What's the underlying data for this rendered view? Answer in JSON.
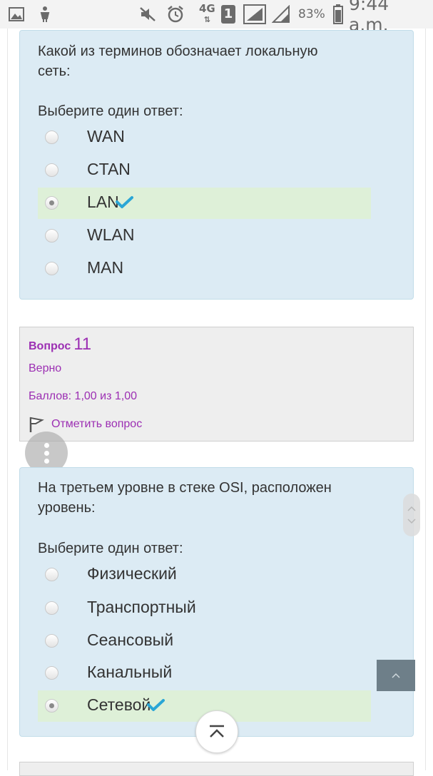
{
  "status_bar": {
    "network": "4G",
    "sim": "1",
    "battery": "83%",
    "time": "9:44 a.m."
  },
  "question_prev": {
    "prompt_line1": "Какой из терминов обозначает локальную",
    "prompt_line2": "сеть:",
    "choose_label": "Выберите один ответ:",
    "options": [
      {
        "text": "WAN",
        "selected": false,
        "correct": false
      },
      {
        "text": "CTAN",
        "selected": false,
        "correct": false
      },
      {
        "text": "LAN",
        "selected": true,
        "correct": true
      },
      {
        "text": "WLAN",
        "selected": false,
        "correct": false
      },
      {
        "text": "MAN",
        "selected": false,
        "correct": false
      }
    ]
  },
  "question_info": {
    "label": "Вопрос",
    "number": "11",
    "state": "Верно",
    "grade": "Баллов: 1,00 из 1,00",
    "flag_label": "Отметить вопрос"
  },
  "question_current": {
    "prompt_line1": "На третьем уровне в стеке OSI, расположен",
    "prompt_line2": "уровень:",
    "choose_label": "Выберите один ответ:",
    "options": [
      {
        "text": "Физический",
        "selected": false,
        "correct": false
      },
      {
        "text": "Транспортный",
        "selected": false,
        "correct": false
      },
      {
        "text": "Сеансовый",
        "selected": false,
        "correct": false
      },
      {
        "text": "Канальный",
        "selected": false,
        "correct": false
      },
      {
        "text": "Сетевой",
        "selected": true,
        "correct": true
      }
    ]
  },
  "colors": {
    "question_bg": "#dcebf4",
    "correct_bg": "#def0d8",
    "info_accent": "#9c2fb3",
    "check": "#2aa6d6"
  }
}
